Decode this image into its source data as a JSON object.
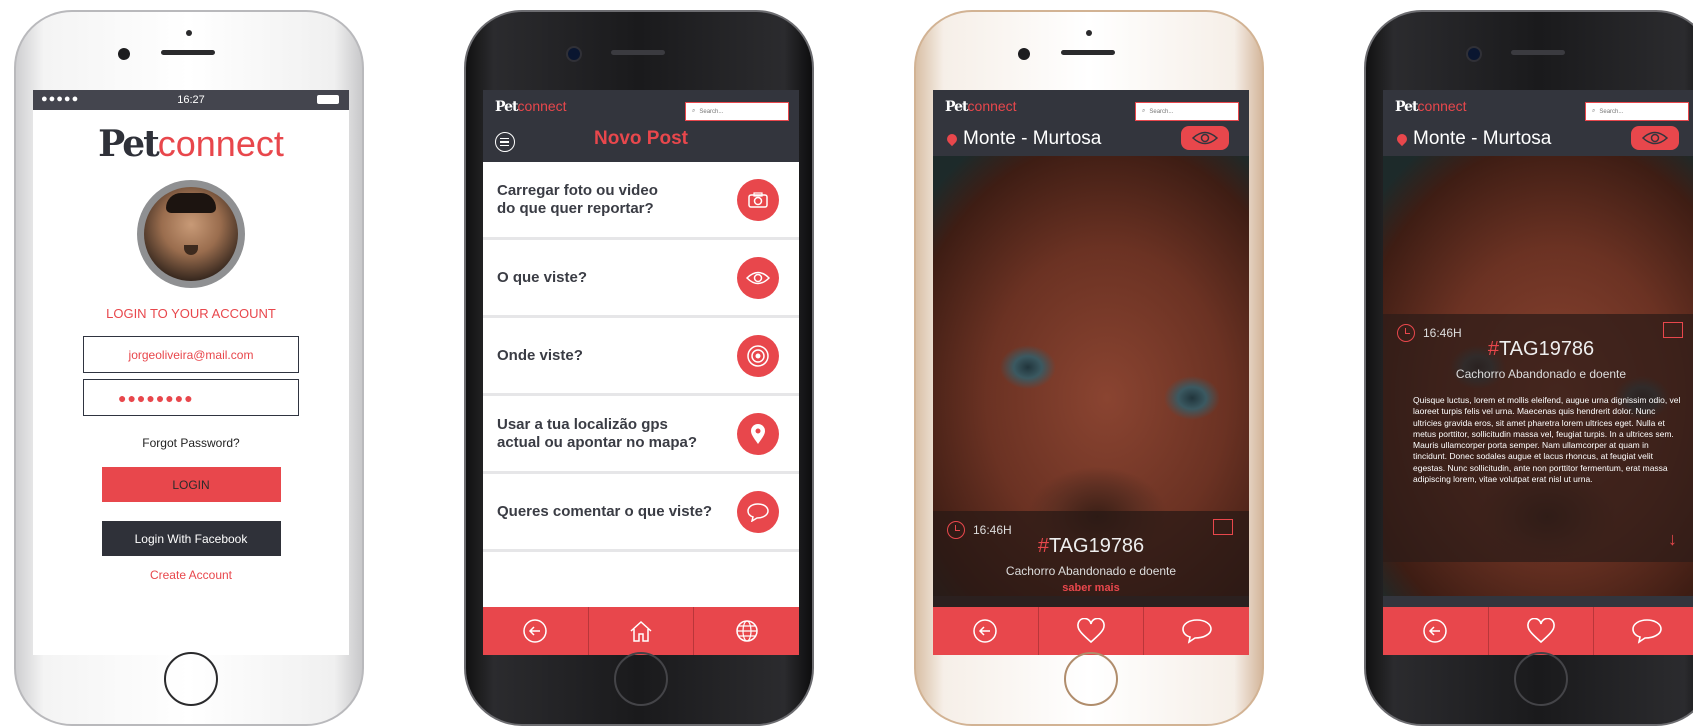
{
  "login_screen": {
    "status_time": "16:27",
    "signal": "●●●●●",
    "logo_pet": "Pet",
    "logo_connect": "connect",
    "title": "LOGIN TO YOUR ACCOUNT",
    "email_value": "jorgeoliveira@mail.com",
    "password_value": "●●●●●●●●",
    "forgot": "Forgot Password?",
    "login_button": "LOGIN",
    "facebook_button": "Login With Facebook",
    "create_account": "Create Account"
  },
  "new_post_screen": {
    "logo_pet": "Pet",
    "logo_connect": "connect",
    "search_placeholder": "Search...",
    "title": "Novo Post",
    "items": [
      {
        "line1": "Carregar foto ou video",
        "line2": "do que quer reportar?",
        "icon": "camera-icon"
      },
      {
        "line1": "O que viste?",
        "line2": "",
        "icon": "eye-icon"
      },
      {
        "line1": "Onde viste?",
        "line2": "",
        "icon": "target-icon"
      },
      {
        "line1": "Usar a tua localizão gps",
        "line2": "actual ou apontar no mapa?",
        "icon": "location-pin-icon"
      },
      {
        "line1": "Queres comentar o que viste?",
        "line2": "",
        "icon": "comment-icon"
      }
    ]
  },
  "detail_screen": {
    "logo_pet": "Pet",
    "logo_connect": "connect",
    "search_placeholder": "Search...",
    "location": "Monte - Murtosa",
    "time": "16:46H",
    "tag_hash": "#",
    "tag": "TAG19786",
    "subtitle": "Cachorro Abandonado e doente",
    "more": "saber mais"
  },
  "expanded_screen": {
    "logo_pet": "Pet",
    "logo_connect": "connect",
    "search_placeholder": "Search...",
    "location": "Monte - Murtosa",
    "time": "16:46H",
    "tag_hash": "#",
    "tag": "TAG19786",
    "subtitle": "Cachorro Abandonado e doente",
    "description": "Quisque luctus, lorem et mollis eleifend, augue urna dignissim odio, vel laoreet turpis felis vel urna. Maecenas quis hendrerit dolor. Nunc ultricies gravida eros, sit amet pharetra lorem ultrices eget. Nulla et metus porttitor, sollicitudin massa vel, feugiat turpis. In a ultrices sem. Mauris ullamcorper porta semper. Nam ullamcorper at quam in tincidunt. Donec sodales augue et lacus rhoncus, at feugiat velit egestas. Nunc sollicitudin, ante non porttitor fermentum, erat massa adipiscing lorem, vitae volutpat erat nisl ut urna."
  },
  "colors": {
    "accent": "#e8474c",
    "header": "#33353d"
  }
}
